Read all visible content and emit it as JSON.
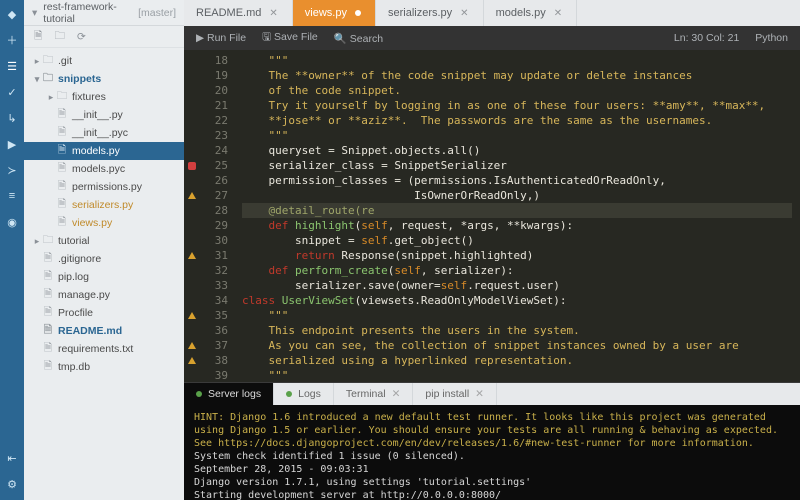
{
  "header": {
    "repo": "rest-framework-tutorial",
    "branch": "[master]"
  },
  "tree": [
    {
      "label": ".git",
      "depth": 0,
      "kind": "folder",
      "open": false
    },
    {
      "label": "snippets",
      "depth": 0,
      "kind": "folder",
      "open": true,
      "bold": true
    },
    {
      "label": "fixtures",
      "depth": 1,
      "kind": "folder",
      "open": false
    },
    {
      "label": "__init__.py",
      "depth": 1,
      "kind": "file"
    },
    {
      "label": "__init__.pyc",
      "depth": 1,
      "kind": "file"
    },
    {
      "label": "models.py",
      "depth": 1,
      "kind": "file",
      "selected": true
    },
    {
      "label": "models.pyc",
      "depth": 1,
      "kind": "file"
    },
    {
      "label": "permissions.py",
      "depth": 1,
      "kind": "file"
    },
    {
      "label": "serializers.py",
      "depth": 1,
      "kind": "file",
      "modified": true
    },
    {
      "label": "views.py",
      "depth": 1,
      "kind": "file",
      "modified": true
    },
    {
      "label": "tutorial",
      "depth": 0,
      "kind": "folder",
      "open": false
    },
    {
      "label": ".gitignore",
      "depth": 0,
      "kind": "file"
    },
    {
      "label": "pip.log",
      "depth": 0,
      "kind": "file"
    },
    {
      "label": "manage.py",
      "depth": 0,
      "kind": "file"
    },
    {
      "label": "Procfile",
      "depth": 0,
      "kind": "file"
    },
    {
      "label": "README.md",
      "depth": 0,
      "kind": "file",
      "bold": true
    },
    {
      "label": "requirements.txt",
      "depth": 0,
      "kind": "file"
    },
    {
      "label": "tmp.db",
      "depth": 0,
      "kind": "file"
    }
  ],
  "tabs": [
    {
      "label": "README.md",
      "active": false,
      "dirty": false
    },
    {
      "label": "views.py",
      "active": true,
      "dirty": true
    },
    {
      "label": "serializers.py",
      "active": false,
      "dirty": false
    },
    {
      "label": "models.py",
      "active": false,
      "dirty": false
    }
  ],
  "toolbar": {
    "run": "Run File",
    "save": "Save File",
    "search": "Search",
    "pos": "Ln: 30 Col: 21",
    "lang": "Python"
  },
  "editor": {
    "first_line": 18,
    "marks": {
      "25": "err",
      "27": "warn",
      "31": "warn",
      "35": "warn",
      "37": "warn",
      "38": "warn"
    },
    "active_line": 30,
    "lines": [
      {
        "t": "    \"\"\"",
        "cls": "str"
      },
      {
        "t": "    The **owner** of the code snippet may update or delete instances",
        "cls": "str"
      },
      {
        "t": "    of the code snippet.",
        "cls": "str"
      },
      {
        "t": "",
        "cls": "str"
      },
      {
        "t": "    Try it yourself by logging in as one of these four users: **amy**, **max**,",
        "cls": "str"
      },
      {
        "t": "    **jose** or **aziz**.  The passwords are the same as the usernames.",
        "cls": "str"
      },
      {
        "t": "    \"\"\"",
        "cls": "str"
      },
      {
        "html": "    queryset = Snippet.objects.all()"
      },
      {
        "html": "    serializer_class = SnippetSerializer"
      },
      {
        "html": "    permission_classes = (permissions.IsAuthenticatedOrReadOnly,"
      },
      {
        "html": "                          IsOwnerOrReadOnly,)"
      },
      {
        "html": ""
      },
      {
        "html": "    <span class='dec'>@detail_route(re</span>",
        "hl": true
      },
      {
        "html": "    <span class='kw'>def</span> <span class='fn'>highlight</span>(<span class='self'>self</span>, request, *args, **kwargs):"
      },
      {
        "html": "        snippet = <span class='self'>self</span>.get_object()"
      },
      {
        "html": "        <span class='kw'>return</span> Response(snippet.highlighted)"
      },
      {
        "html": ""
      },
      {
        "html": "    <span class='kw'>def</span> <span class='fn'>perform_create</span>(<span class='self'>self</span>, serializer):"
      },
      {
        "html": "        serializer.save(owner=<span class='self'>self</span>.request.user)"
      },
      {
        "html": ""
      },
      {
        "html": "<span class='kw'>class</span> <span class='fn'>UserViewSet</span>(viewsets.ReadOnlyModelViewSet):"
      },
      {
        "t": "    \"\"\"",
        "cls": "str"
      },
      {
        "t": "    This endpoint presents the users in the system.",
        "cls": "str"
      },
      {
        "t": "",
        "cls": "str"
      },
      {
        "t": "    As you can see, the collection of snippet instances owned by a user are",
        "cls": "str"
      },
      {
        "t": "    serialized using a hyperlinked representation.",
        "cls": "str"
      },
      {
        "t": "    \"\"\"",
        "cls": "str"
      }
    ]
  },
  "panel": {
    "tabs": [
      {
        "label": "Server logs",
        "active": true,
        "dot": "#5aa14a"
      },
      {
        "label": "Logs",
        "active": false,
        "dot": "#5aa14a"
      },
      {
        "label": "Terminal",
        "active": false,
        "close": true
      },
      {
        "label": "pip install",
        "active": false,
        "close": true
      }
    ],
    "lines": [
      {
        "cls": "y",
        "t": "HINT: Django 1.6 introduced a new default test runner. It looks like this project was generated using Django 1.5 or earlier. You should ensure your tests are all running & behaving as expected. See https://docs.djangoproject.com/en/dev/releases/1.6/#new-test-runner for more information."
      },
      {
        "t": ""
      },
      {
        "t": "System check identified 1 issue (0 silenced)."
      },
      {
        "t": "September 28, 2015 - 09:03:31"
      },
      {
        "t": "Django version 1.7.1, using settings 'tutorial.settings'"
      },
      {
        "t": "Starting development server at http://0.0.0.0:8000/"
      }
    ]
  }
}
